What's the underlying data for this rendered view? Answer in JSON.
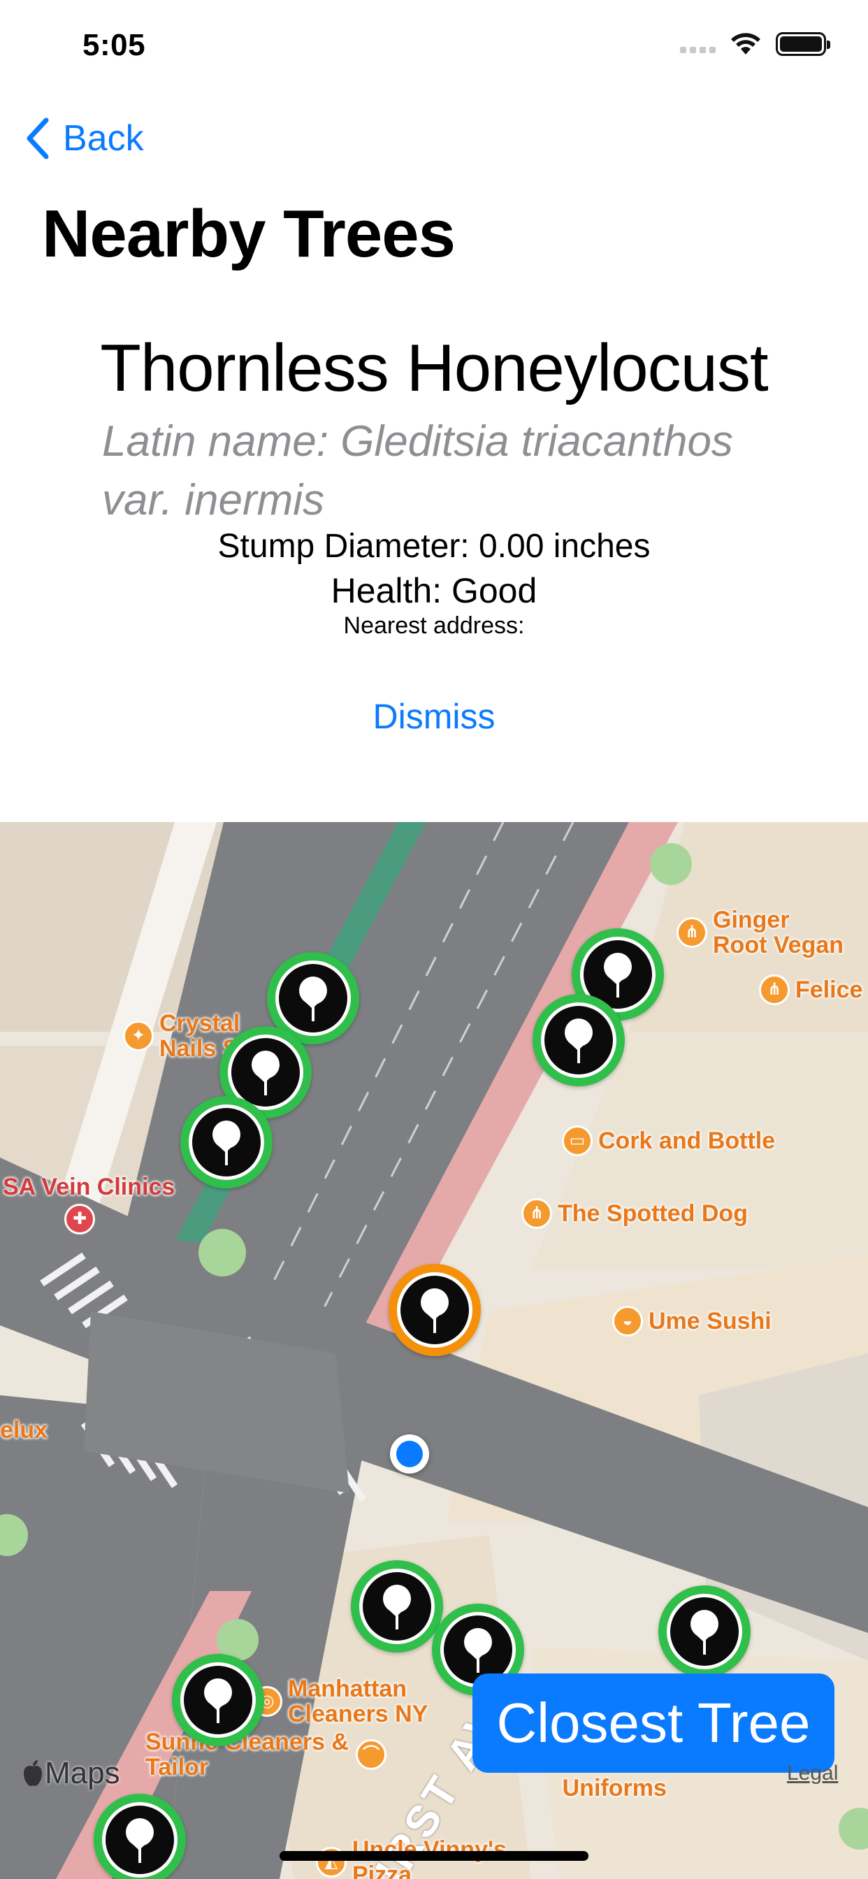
{
  "status_bar": {
    "time": "5:05"
  },
  "nav": {
    "back_label": "Back",
    "title": "Nearby Trees"
  },
  "detail": {
    "common_name": "Thornless Honeylocust",
    "latin_name": "Latin name: Gleditsia triacanthos var. inermis",
    "stump_diameter": "Stump Diameter: 0.00 inches",
    "health": "Health: Good",
    "nearest_address": "Nearest address:",
    "dismiss_label": "Dismiss"
  },
  "map": {
    "street_label": "FIRST AVE",
    "pois": [
      {
        "label": "Ginger\nRoot Vegan",
        "icon": "fork-knife-icon"
      },
      {
        "label": "Felice",
        "icon": "fork-knife-icon"
      },
      {
        "label": "Crystal\nNails S",
        "icon": "nail-salon-icon"
      },
      {
        "label": "Cork and Bottle",
        "icon": "store-icon"
      },
      {
        "label": "SA Vein Clinics",
        "icon": "stethoscope-icon"
      },
      {
        "label": "The Spotted Dog",
        "icon": "fork-knife-icon"
      },
      {
        "label": "Ume Sushi",
        "icon": "sushi-icon"
      },
      {
        "label": "elux",
        "icon": ""
      },
      {
        "label": "Manhattan\nCleaners NY",
        "icon": "laundry-icon"
      },
      {
        "label": "Sunne Cleaners &\nTailor",
        "icon": "hanger-icon"
      },
      {
        "label": "Mr. & Mrs.\nUniforms",
        "icon": ""
      },
      {
        "label": "Uncle Vinny's\nPizza",
        "icon": "pizza-icon"
      }
    ],
    "closest_tree_label": "Closest Tree",
    "maps_logo": "Maps",
    "legal_label": "Legal",
    "colors": {
      "tree_marker": "#2fbf4a",
      "selected_marker": "#f5900a",
      "accent": "#0a7aff"
    }
  }
}
